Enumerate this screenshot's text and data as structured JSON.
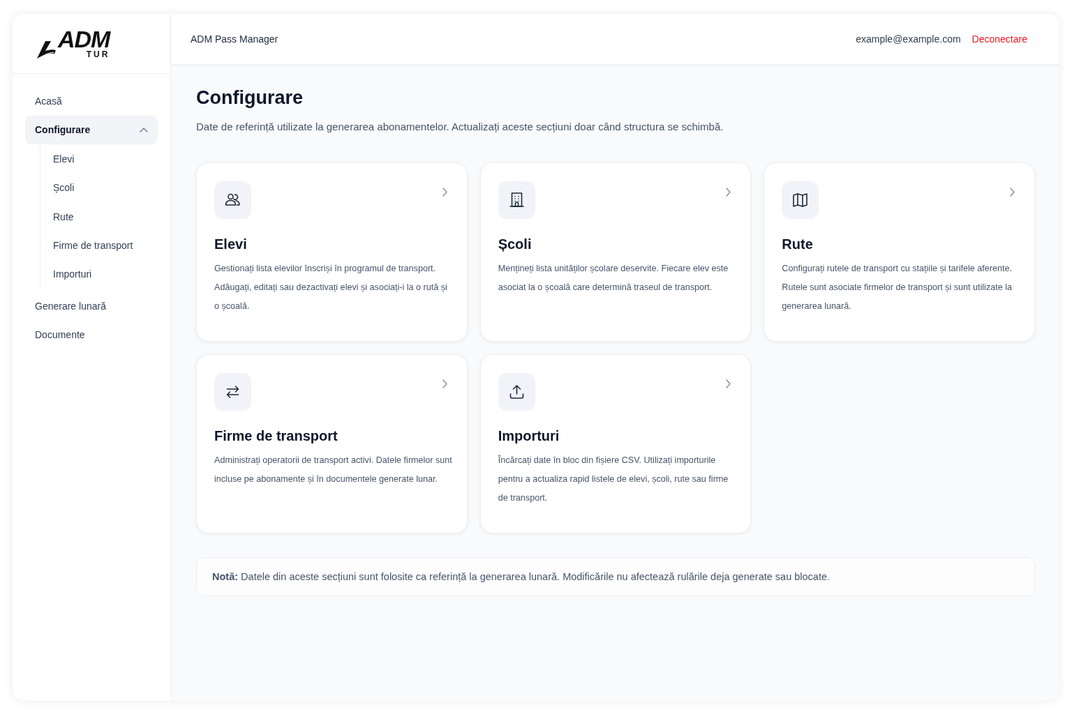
{
  "logo": {
    "title": "ADM",
    "subtitle": "TUR"
  },
  "sidebar": {
    "items": [
      {
        "label": "Acasă",
        "selected": false
      },
      {
        "label": "Configurare",
        "selected": true,
        "expanded": true,
        "children": [
          {
            "label": "Elevi",
            "selected": false
          },
          {
            "label": "Școli",
            "selected": false
          },
          {
            "label": "Rute",
            "selected": false
          },
          {
            "label": "Firme de transport",
            "selected": false
          },
          {
            "label": "Importuri",
            "selected": false
          }
        ]
      },
      {
        "label": "Generare lunară",
        "selected": false
      },
      {
        "label": "Documente",
        "selected": false
      }
    ]
  },
  "header": {
    "app_name": "ADM Pass Manager",
    "user_email": "example@example.com",
    "logout": "Deconectare"
  },
  "page": {
    "title": "Configurare",
    "subtitle": "Date de referință utilizate la generarea abonamentelor. Actualizați aceste secțiuni doar când structura se schimbă."
  },
  "cards": [
    {
      "kind": "students",
      "title": "Elevi",
      "description": "Gestionați lista elevilor înscriși în programul de transport. Adăugați, editați sau dezactivați elevi și asociați-i la o rută și o școală."
    },
    {
      "kind": "schools",
      "title": "Școli",
      "description": "Mențineți lista unităților școlare deservite. Fiecare elev este asociat la o școală care determină traseul de transport."
    },
    {
      "kind": "routes",
      "title": "Rute",
      "description": "Configurați rutele de transport cu stațiile și tarifele aferente. Rutele sunt asociate firmelor de transport și sunt utilizate la generarea lunară."
    },
    {
      "kind": "companies",
      "title": "Firme de transport",
      "description": "Administrați operatorii de transport activi. Datele firmelor sunt incluse pe abonamente și în documentele generate lunar."
    },
    {
      "kind": "imports",
      "title": "Importuri",
      "description": "Încărcați date în bloc din fișiere CSV. Utilizați importurile pentru a actualiza rapid listele de elevi, școli, rute sau firme de transport."
    }
  ],
  "note": "**Notă:** Datele din aceste secțiuni sunt folosite ca referință la generarea lunară. Modificările nu afectează rulările deja generate sau blocate."
}
